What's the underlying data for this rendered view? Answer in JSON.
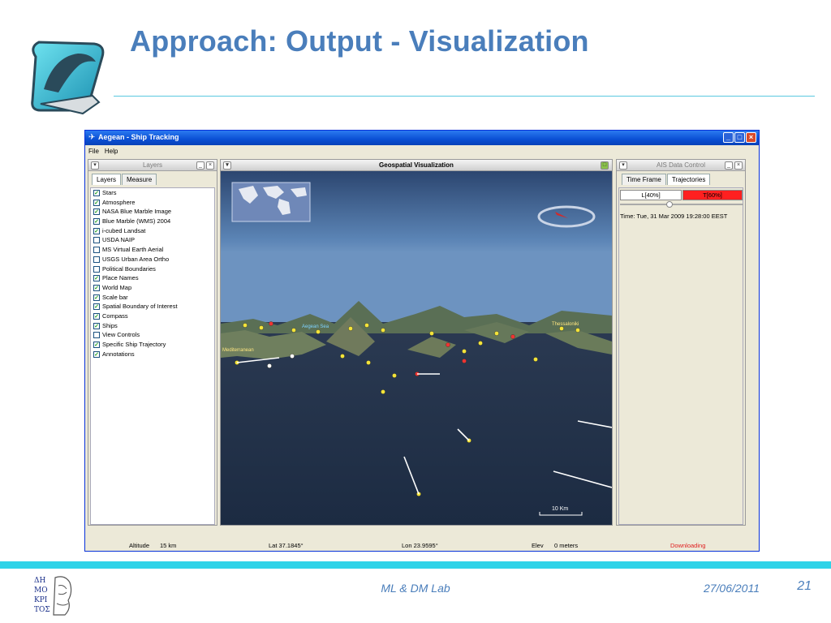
{
  "slide": {
    "title": "Approach: Output - Visualization",
    "footer_center": "ML & DM Lab",
    "footer_date": "27/06/2011",
    "page_number": "21",
    "accent_color": "#4a7ebb",
    "rule_color": "#2fd3e8"
  },
  "app": {
    "window_title": "Aegean - Ship Tracking",
    "menu": [
      "File",
      "Help"
    ],
    "layers_panel": {
      "header": "Layers",
      "tabs": [
        "Layers",
        "Measure"
      ],
      "items": [
        {
          "label": "Stars",
          "checked": true
        },
        {
          "label": "Atmosphere",
          "checked": true
        },
        {
          "label": "NASA Blue Marble Image",
          "checked": true
        },
        {
          "label": "Blue Marble (WMS) 2004",
          "checked": true
        },
        {
          "label": "i-cubed Landsat",
          "checked": true
        },
        {
          "label": "USDA NAIP",
          "checked": false
        },
        {
          "label": "MS Virtual Earth Aerial",
          "checked": false
        },
        {
          "label": "USGS Urban Area Ortho",
          "checked": false
        },
        {
          "label": "Political Boundaries",
          "checked": false
        },
        {
          "label": "Place Names",
          "checked": true
        },
        {
          "label": "World Map",
          "checked": true
        },
        {
          "label": "Scale bar",
          "checked": true
        },
        {
          "label": "Spatial Boundary of Interest",
          "checked": true
        },
        {
          "label": "Compass",
          "checked": true
        },
        {
          "label": "Ships",
          "checked": true
        },
        {
          "label": "View Controls",
          "checked": false
        },
        {
          "label": "Specific Ship Trajectory",
          "checked": true
        },
        {
          "label": "Annotations",
          "checked": true
        }
      ]
    },
    "map_panel": {
      "header": "Geospatial Visualization",
      "scale_label": "10 Km",
      "place_labels": [
        "Aegean Sea",
        "Thessaloniki",
        "Mediterranean"
      ]
    },
    "ais_panel": {
      "header": "AIS Data Control",
      "tabs": [
        "Time Frame",
        "Trajectories"
      ],
      "l_label": "L[40%]",
      "t_label": "T[60%]",
      "time": "Time: Tue, 31 Mar 2009 19:28:00 EEST"
    },
    "status": {
      "altitude_label": "Altitude",
      "altitude_value": "15 km",
      "lat": "Lat 37.1845°",
      "lon": "Lon 23.9595°",
      "elev_label": "Elev",
      "elev_value": "0 meters",
      "downloading": "Downloading"
    }
  }
}
